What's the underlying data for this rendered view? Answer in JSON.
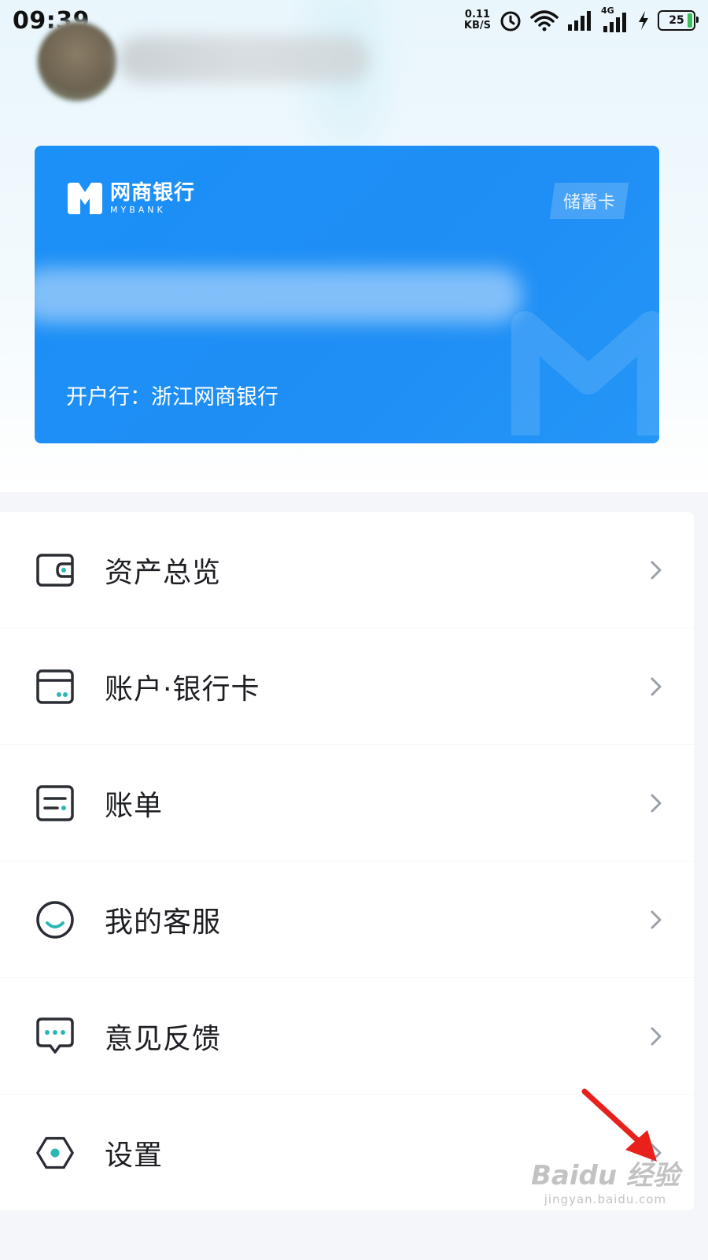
{
  "status_bar": {
    "time": "09:39",
    "net_speed_value": "0.11",
    "net_speed_unit": "KB/S",
    "network_type": "4G",
    "battery": "25"
  },
  "card": {
    "bank_name": "网商银行",
    "bank_name_en": "MYBANK",
    "card_type": "储蓄卡",
    "open_bank": "开户行：浙江网商银行"
  },
  "menu": {
    "items": [
      {
        "label": "资产总览",
        "icon": "wallet-icon"
      },
      {
        "label": "账户·银行卡",
        "icon": "bank-card-icon"
      },
      {
        "label": "账单",
        "icon": "bill-icon"
      },
      {
        "label": "我的客服",
        "icon": "customer-service-icon"
      },
      {
        "label": "意见反馈",
        "icon": "feedback-icon"
      },
      {
        "label": "设置",
        "icon": "settings-icon"
      }
    ]
  },
  "watermark": {
    "main": "Baidu 经验",
    "sub": "jingyan.baidu.com"
  },
  "colors": {
    "card_blue": "#1f8ef5",
    "teal_accent": "#2bb8b5",
    "arrow_red": "#e8211c"
  }
}
